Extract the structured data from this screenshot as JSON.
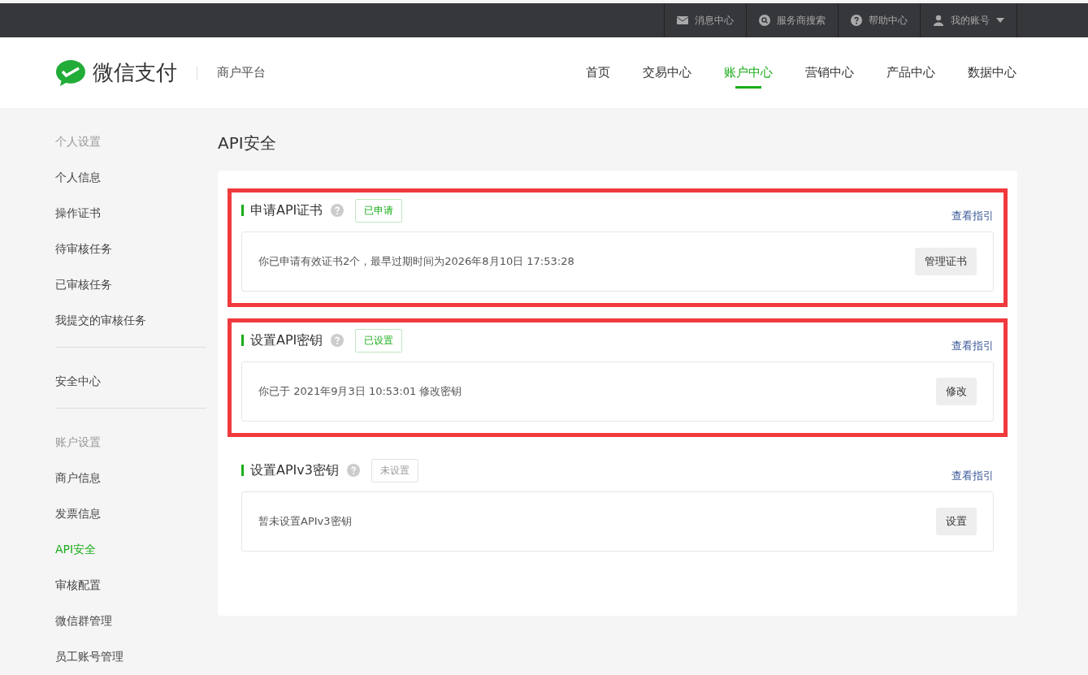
{
  "topbar": {
    "links": [
      {
        "kind": "mail",
        "label": "消息中心"
      },
      {
        "kind": "search",
        "label": "服务商搜索"
      },
      {
        "kind": "help",
        "label": "帮助中心"
      },
      {
        "kind": "user",
        "label": "我的账号",
        "dropdown": true
      }
    ]
  },
  "header": {
    "brand": "微信支付",
    "subtitle": "商户平台",
    "nav": [
      {
        "label": "首页",
        "selected": false
      },
      {
        "label": "交易中心",
        "selected": false
      },
      {
        "label": "账户中心",
        "selected": true
      },
      {
        "label": "营销中心",
        "selected": false
      },
      {
        "label": "产品中心",
        "selected": false
      },
      {
        "label": "数据中心",
        "selected": false
      }
    ]
  },
  "sidebar": {
    "items": [
      {
        "kind": "header",
        "label": "个人设置"
      },
      {
        "kind": "item",
        "label": "个人信息",
        "selected": false
      },
      {
        "kind": "item",
        "label": "操作证书",
        "selected": false
      },
      {
        "kind": "item",
        "label": "待审核任务",
        "selected": false
      },
      {
        "kind": "item",
        "label": "已审核任务",
        "selected": false
      },
      {
        "kind": "item",
        "label": "我提交的审核任务",
        "selected": false
      },
      {
        "kind": "divider"
      },
      {
        "kind": "item",
        "label": "安全中心",
        "selected": false
      },
      {
        "kind": "divider"
      },
      {
        "kind": "header",
        "label": "账户设置"
      },
      {
        "kind": "item",
        "label": "商户信息",
        "selected": false
      },
      {
        "kind": "item",
        "label": "发票信息",
        "selected": false
      },
      {
        "kind": "item",
        "label": "API安全",
        "selected": true
      },
      {
        "kind": "item",
        "label": "审核配置",
        "selected": false
      },
      {
        "kind": "item",
        "label": "微信群管理",
        "selected": false
      },
      {
        "kind": "item",
        "label": "员工账号管理",
        "selected": false
      }
    ]
  },
  "page_title": "API安全",
  "sections": [
    {
      "title": "申请API证书",
      "status": "已申请",
      "done": true,
      "guide_link": "查看指引",
      "message": "你已申请有效证书2个，最早过期时间为2026年8月10日 17:53:28",
      "button": "管理证书",
      "highlighted": true
    },
    {
      "title": "设置API密钥",
      "status": "已设置",
      "done": true,
      "guide_link": "查看指引",
      "message": "你已于 2021年9月3日 10:53:01 修改密钥",
      "button": "修改",
      "highlighted": true
    },
    {
      "title": "设置APIv3密钥",
      "status": "未设置",
      "done": false,
      "guide_link": "查看指引",
      "message": "暂未设置APIv3密钥",
      "button": "设置",
      "highlighted": false
    }
  ]
}
